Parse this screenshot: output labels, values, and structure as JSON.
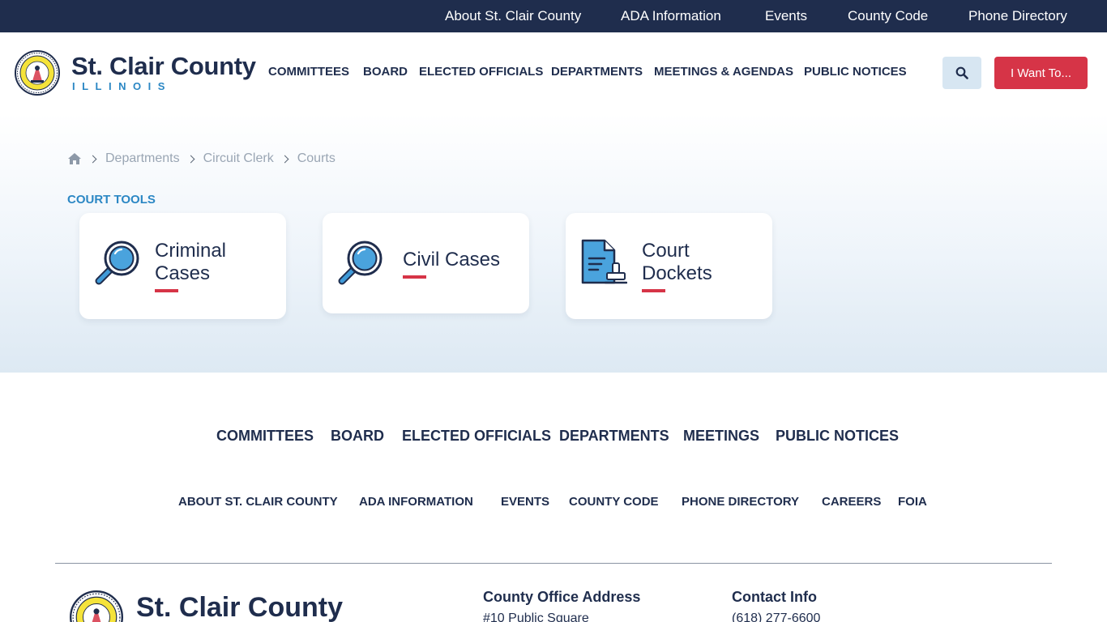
{
  "topbar": {
    "links": [
      "About St. Clair County",
      "ADA Information",
      "Events",
      "County Code",
      "Phone Directory"
    ]
  },
  "header": {
    "brand_name": "St. Clair County",
    "brand_state": "ILLINOIS",
    "nav": [
      "COMMITTEES",
      "BOARD",
      "ELECTED OFFICIALS",
      "DEPARTMENTS",
      "MEETINGS & AGENDAS",
      "PUBLIC NOTICES"
    ],
    "want_label": "I Want To..."
  },
  "breadcrumb": [
    "Departments",
    "Circuit Clerk",
    "Courts"
  ],
  "section_label": "COURT TOOLS",
  "cards": [
    {
      "title_line1": "Criminal",
      "title_line2": "Cases",
      "icon": "magnifier-icon"
    },
    {
      "title_line1": "Civil Cases",
      "title_line2": "",
      "icon": "magnifier-icon"
    },
    {
      "title_line1": "Court",
      "title_line2": "Dockets",
      "icon": "document-stamp-icon"
    }
  ],
  "footer": {
    "nav_primary": [
      "COMMITTEES",
      "BOARD",
      "ELECTED OFFICIALS",
      "DEPARTMENTS",
      "MEETINGS",
      "PUBLIC NOTICES"
    ],
    "nav_secondary": [
      "ABOUT ST. CLAIR COUNTY",
      "ADA INFORMATION",
      "EVENTS",
      "COUNTY CODE",
      "PHONE DIRECTORY",
      "CAREERS",
      "FOIA"
    ],
    "brand_name": "St. Clair County",
    "address_heading": "County Office Address",
    "address_line1": "#10 Public Square",
    "contact_heading": "Contact Info",
    "phone": "(618) 277-6600"
  },
  "colors": {
    "navy": "#1f2d4d",
    "accent_blue": "#2b87c4",
    "accent_red": "#d63447",
    "icon_blue": "#3f9ad8"
  }
}
